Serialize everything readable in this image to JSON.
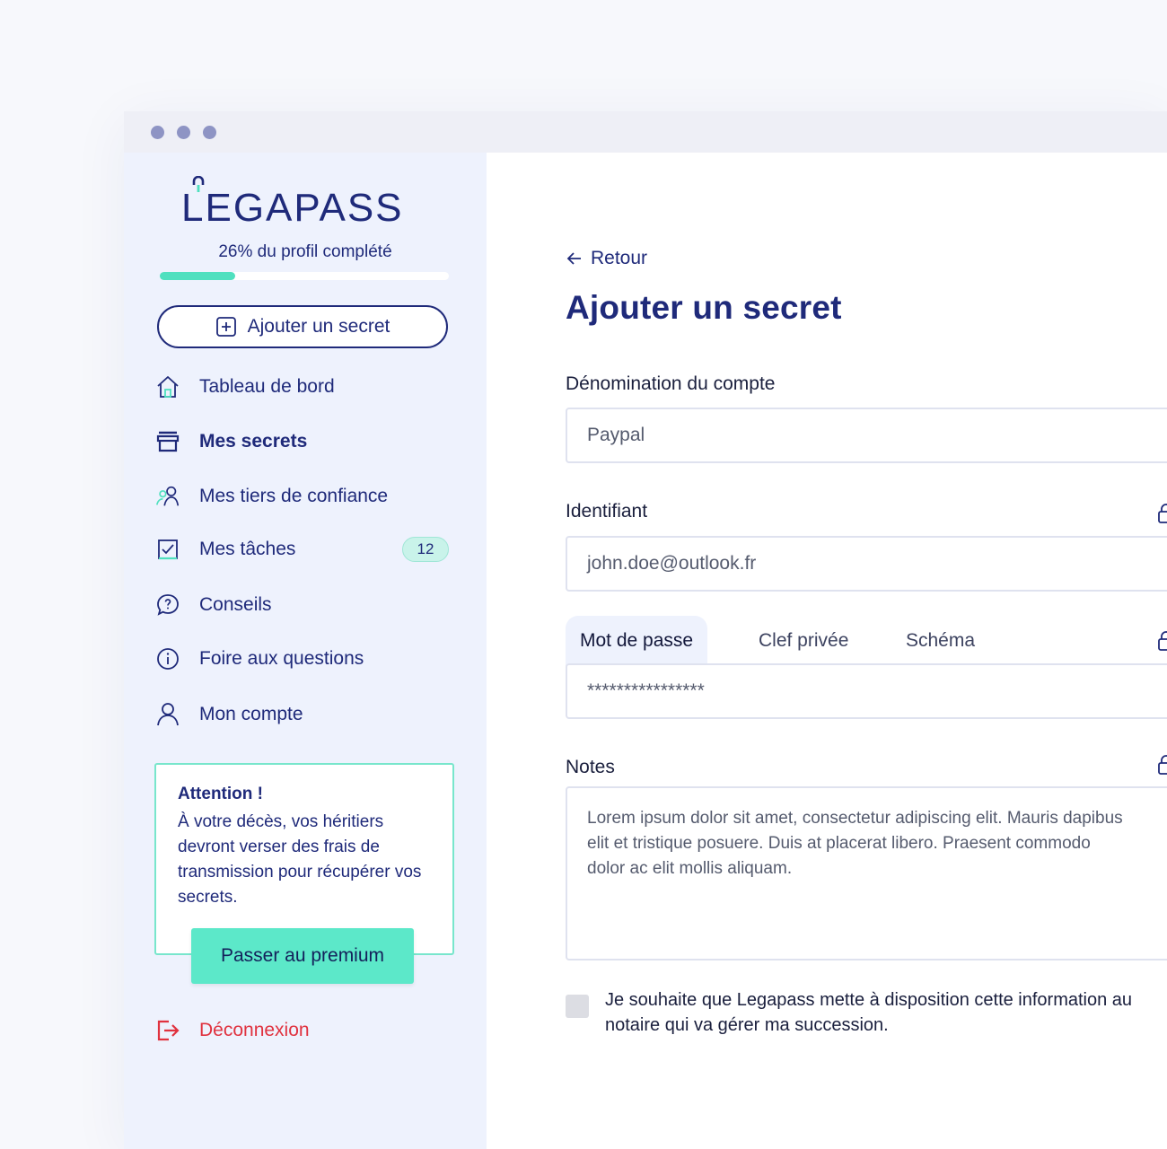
{
  "window": {
    "dots": [
      "window-dot-1",
      "window-dot-2",
      "window-dot-3"
    ]
  },
  "sidebar": {
    "logo_text": "EGAPASS",
    "logo_prefix": "L",
    "progress": {
      "label": "26% du profil complété",
      "value": 26
    },
    "add_button": "Ajouter un secret",
    "nav": [
      {
        "id": "dashboard",
        "label": "Tableau de bord",
        "icon": "home-icon",
        "active": false
      },
      {
        "id": "secrets",
        "label": "Mes secrets",
        "icon": "archive-icon",
        "active": true
      },
      {
        "id": "trusted",
        "label": "Mes tiers de confiance",
        "icon": "users-icon",
        "active": false
      },
      {
        "id": "tasks",
        "label": "Mes tâches",
        "icon": "checkbox-icon",
        "active": false,
        "badge": "12"
      },
      {
        "id": "tips",
        "label": "Conseils",
        "icon": "chat-question-icon",
        "active": false
      },
      {
        "id": "faq",
        "label": "Foire aux questions",
        "icon": "info-icon",
        "active": false
      },
      {
        "id": "account",
        "label": "Mon compte",
        "icon": "user-icon",
        "active": false
      }
    ],
    "alert": {
      "title": "Attention !",
      "body": "À votre décès, vos héritiers devront verser des frais de transmission pour récupérer vos secrets.",
      "button": "Passer au premium"
    },
    "logout": "Déconnexion"
  },
  "main": {
    "back": "Retour",
    "title": "Ajouter un secret",
    "account_name": {
      "label": "Dénomination du compte",
      "value": "Paypal"
    },
    "identifier": {
      "label": "Identifiant",
      "value": "john.doe@outlook.fr"
    },
    "secret_tabs": [
      "Mot de passe",
      "Clef privée",
      "Schéma"
    ],
    "password_value": "****************",
    "notes": {
      "label": "Notes",
      "value": "Lorem ipsum dolor sit amet, consectetur adipiscing elit. Mauris dapibus\nelit et tristique posuere. Duis at placerat libero. Praesent commodo\ndolor ac elit mollis aliquam."
    },
    "consent_text": "Je souhaite que Legapass mette à disposition cette information au\nnotaire qui va gérer ma succession.",
    "colors": {
      "primary": "#1f2a7a",
      "accent": "#5ce8c9",
      "danger": "#e0323f",
      "sidebar_bg": "#eef2fd"
    }
  }
}
